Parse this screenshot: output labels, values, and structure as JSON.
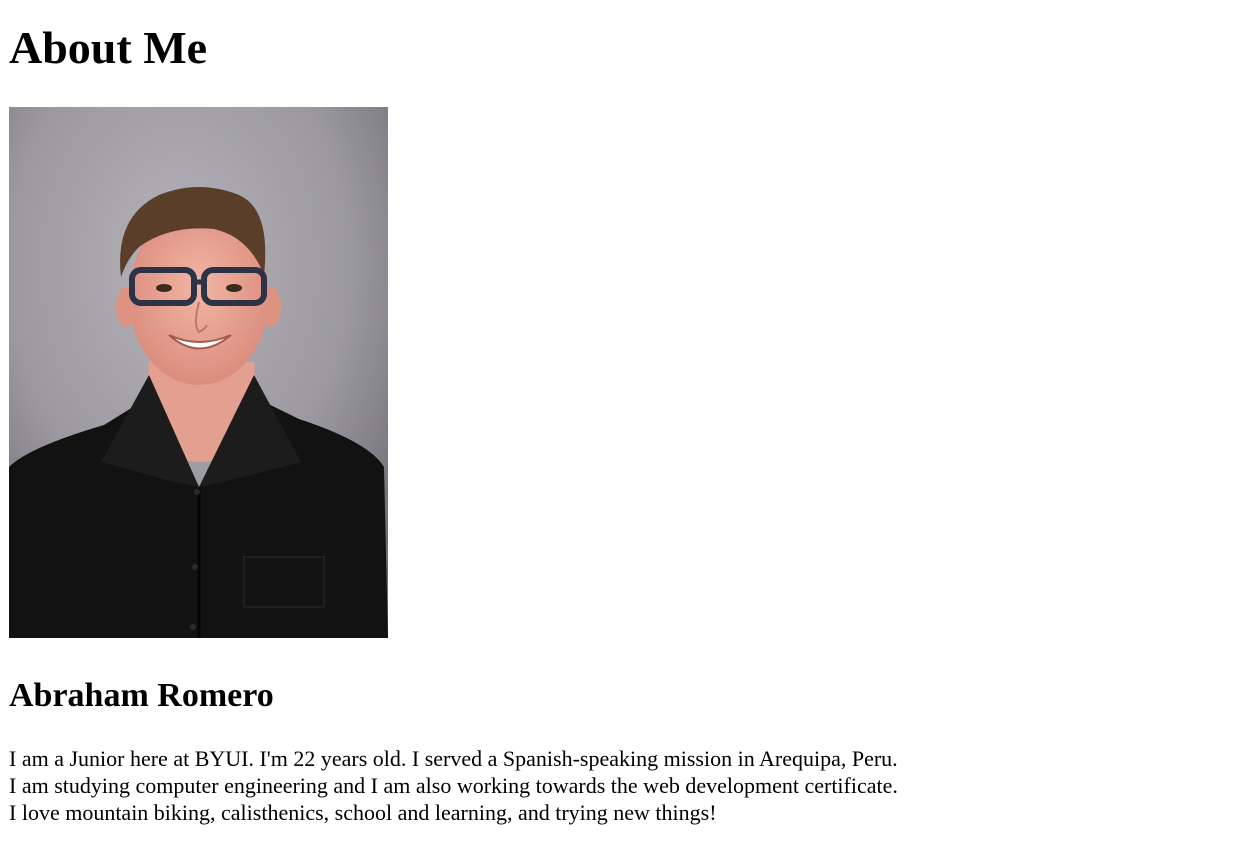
{
  "page": {
    "title": "About Me"
  },
  "profile": {
    "photo_icon": "portrait-photo",
    "name": "Abraham Romero",
    "bio_lines": [
      "I am a Junior here at BYUI. I'm 22 years old. I served a Spanish-speaking mission in Arequipa, Peru.",
      "I am studying computer engineering and I am also working towards the web development certificate.",
      "I love mountain biking, calisthenics, school and learning, and trying new things!"
    ]
  },
  "colors": {
    "background": "#ffffff",
    "text": "#000000",
    "photo_backdrop": "#9a979e",
    "shirt": "#111111"
  }
}
